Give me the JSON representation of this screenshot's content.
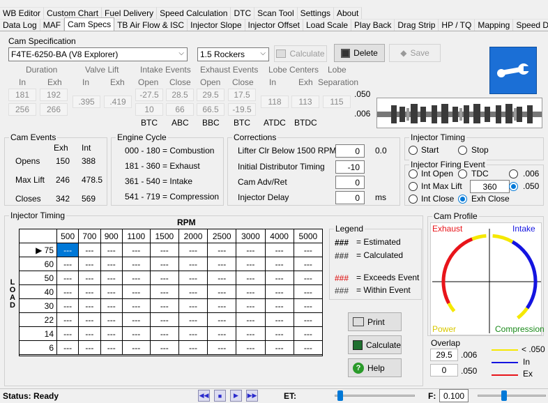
{
  "tabs_row1": [
    "WB Editor",
    "Custom Chart",
    "Fuel Delivery",
    "Speed Calculation",
    "DTC",
    "Scan Tool",
    "Settings",
    "About"
  ],
  "tabs_row2": [
    "Data Log",
    "MAF",
    "Cam Specs",
    "TB Air Flow & ISC",
    "Injector Slope",
    "Injector Offset",
    "Load Scale",
    "Play Back",
    "Drag Strip",
    "HP / TQ",
    "Mapping",
    "Speed Density"
  ],
  "cam_spec": {
    "title": "Cam Specification",
    "cam_select": "F4TE-6250-BA (V8 Explorer)",
    "rocker_select": "1.5 Rockers",
    "calculate": "Calculate",
    "delete": "Delete",
    "save": "Save",
    "h_duration": "Duration",
    "h_valve_lift": "Valve Lift",
    "h_intake_events": "Intake Events",
    "h_exhaust_events": "Exhaust Events",
    "h_lobe_centers": "Lobe Centers",
    "h_lobe": "Lobe",
    "s_in": "In",
    "s_exh": "Exh",
    "s_in2": "In",
    "s_exh2": "Exh",
    "s_open": "Open",
    "s_close": "Close",
    "s_open2": "Open",
    "s_close2": "Close",
    "s_in3": "In",
    "s_exh3": "Exh",
    "s_sep": "Separation",
    "dur_in": [
      "181",
      "256"
    ],
    "dur_exh": [
      "192",
      "266"
    ],
    "lift_in": ".395",
    "lift_exh": ".419",
    "int_open": [
      "-27.5",
      "10"
    ],
    "int_close": [
      "28.5",
      "66"
    ],
    "exh_open": [
      "29.5",
      "66.5"
    ],
    "exh_close": [
      "17.5",
      "-19.5"
    ],
    "lc_in": "118",
    "lc_exh": "113",
    "lobe_sep": "115",
    "v050": ".050",
    "v006": ".006",
    "b_btc": "BTC",
    "b_abc": "ABC",
    "b_bbc": "BBC",
    "b_btc2": "BTC",
    "b_atdc": "ATDC",
    "b_btdc": "BTDC"
  },
  "cam_events": {
    "title": "Cam Events",
    "h_exh": "Exh",
    "h_int": "Int",
    "r1": "Opens",
    "r2": "Max Lift",
    "r3": "Closes",
    "opens": [
      "150",
      "388"
    ],
    "maxlift": [
      "246",
      "478.5"
    ],
    "closes": [
      "342",
      "569"
    ]
  },
  "engine_cycle": {
    "title": "Engine Cycle",
    "lines": [
      "000 - 180 = Combustion",
      "181 - 360 = Exhaust",
      "361 - 540 = Intake",
      "541 - 719 = Compression"
    ]
  },
  "corrections": {
    "title": "Corrections",
    "l1": "Lifter Clr Below 1500 RPM",
    "v1": "0",
    "r1": "0.0",
    "l2": "Initial Distributor Timing",
    "v2": "-10",
    "l3": "Cam Adv/Ret",
    "v3": "0",
    "l4": "Injector Delay",
    "v4": "0",
    "unit": "ms"
  },
  "injector_timing_opts": {
    "title": "Injector  Timing",
    "start": "Start",
    "stop": "Stop",
    "firing_title": "Injector Firing Event",
    "int_open": "Int Open",
    "tdc": "TDC",
    "v006": ".006",
    "int_max": "Int Max Lift",
    "int_max_val": "360",
    "v050": ".050",
    "int_close": "Int Close",
    "exh_close": "Exh Close"
  },
  "injector_grid": {
    "title": "Injector Timing",
    "rpm_label": "RPM",
    "load_label": "LOAD",
    "rpm": [
      "500",
      "700",
      "900",
      "1100",
      "1500",
      "2000",
      "2500",
      "3000",
      "4000",
      "5000"
    ],
    "load": [
      "75",
      "60",
      "50",
      "40",
      "30",
      "22",
      "14",
      "6"
    ],
    "cell": "---"
  },
  "legend": {
    "title": "Legend",
    "hash": "###",
    "estimated": "= Estimated",
    "calculated": "= Calculated",
    "exceeds": "= Exceeds Event",
    "within": "= Within Event"
  },
  "buttons": {
    "print": "Print",
    "calculate": "Calculate",
    "help": "Help"
  },
  "cam_profile": {
    "title": "Cam Profile",
    "exhaust": "Exhaust",
    "intake": "Intake",
    "power": "Power",
    "compression": "Compression",
    "overlap_title": "Overlap",
    "ov1": "29.5",
    "ov1l": ".006",
    "ov2": "0",
    "ov2l": ".050",
    "key1": "< .050",
    "key2": "In",
    "key3": "Ex",
    "colors": {
      "exhaust": "#e8141a",
      "intake": "#1414e0",
      "overlap": "#f5e800"
    }
  },
  "status": {
    "text": "Status: Ready",
    "et": "ET:",
    "f": "F:",
    "f_val": "0.100"
  }
}
